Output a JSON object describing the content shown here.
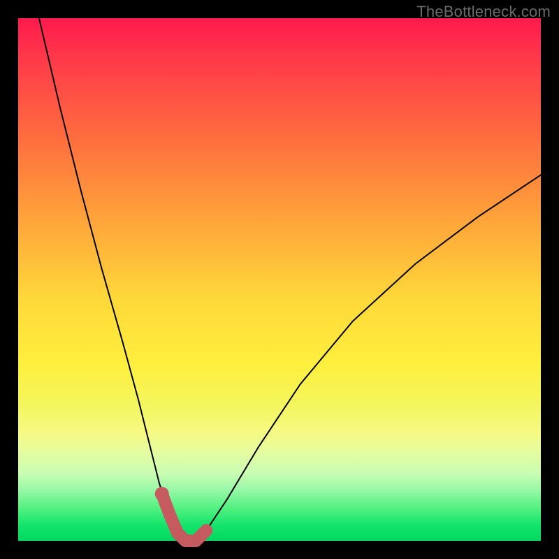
{
  "watermark": "TheBottleneck.com",
  "chart_data": {
    "type": "line",
    "title": "",
    "xlabel": "",
    "ylabel": "",
    "xlim": [
      0,
      100
    ],
    "ylim": [
      0,
      100
    ],
    "grid": false,
    "legend": false,
    "annotations": [],
    "background_gradient": {
      "top_color": "#ff1a4d",
      "mid_color": "#ffe83a",
      "bottom_color": "#00d860",
      "meaning": "top = high bottleneck, bottom = 0% bottleneck"
    },
    "series": [
      {
        "name": "bottleneck-curve",
        "x": [
          4,
          8,
          12,
          16,
          20,
          23,
          25,
          27,
          29,
          30.5,
          32,
          34,
          36,
          40,
          46,
          54,
          64,
          76,
          88,
          100
        ],
        "y": [
          100,
          83,
          67,
          52,
          38,
          27,
          19,
          11,
          5,
          1.5,
          0,
          0,
          2,
          8,
          18,
          30,
          42,
          53,
          62,
          70
        ]
      }
    ],
    "highlight": {
      "name": "optimal-range",
      "color": "#c65b5f",
      "marker_at_start": true,
      "x": [
        27.5,
        29,
        30.5,
        32,
        34,
        36
      ],
      "y": [
        9,
        5,
        1.5,
        0,
        0,
        2
      ]
    }
  }
}
